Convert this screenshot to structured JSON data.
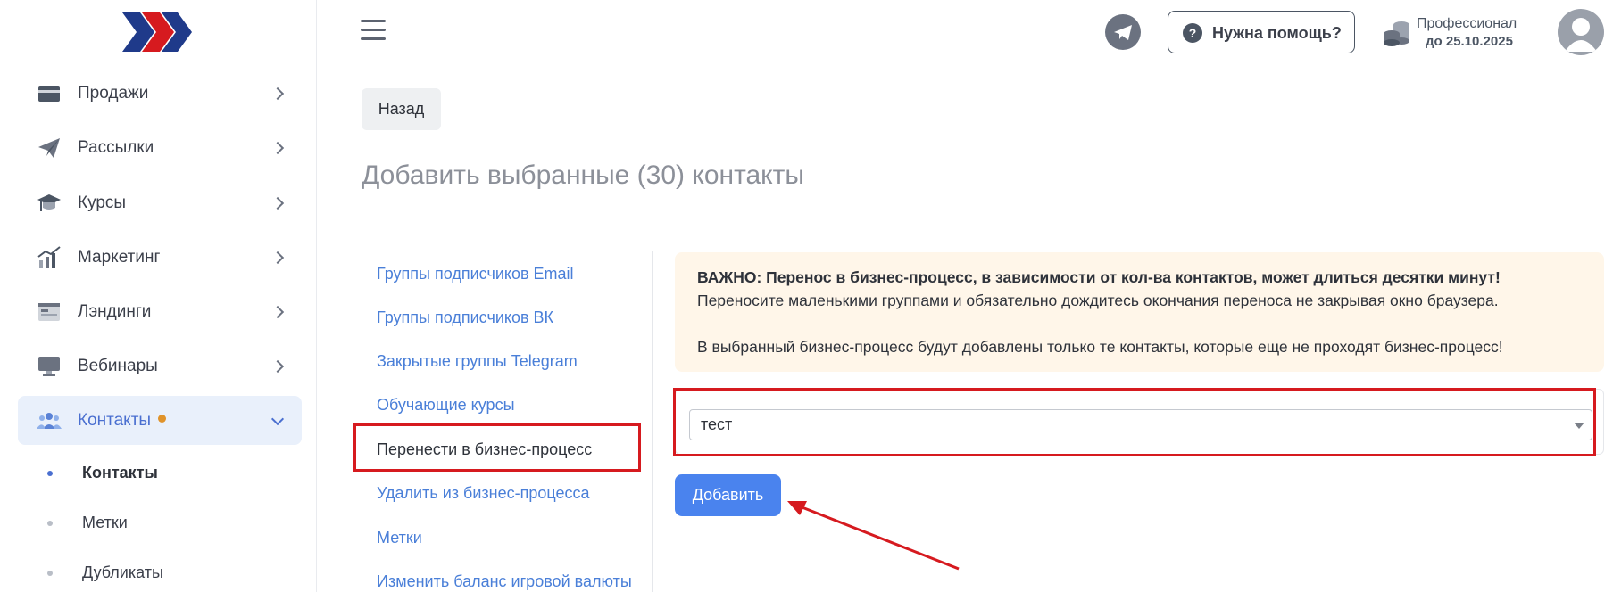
{
  "sidebar": {
    "items": [
      {
        "label": "Продажи",
        "icon": "card-icon"
      },
      {
        "label": "Рассылки",
        "icon": "paper-plane-icon"
      },
      {
        "label": "Курсы",
        "icon": "graduation-cap-icon"
      },
      {
        "label": "Маркетинг",
        "icon": "chart-icon"
      },
      {
        "label": "Лэндинги",
        "icon": "landing-page-icon"
      },
      {
        "label": "Вебинары",
        "icon": "monitor-icon"
      },
      {
        "label": "Контакты",
        "icon": "users-icon"
      }
    ],
    "subitems": [
      {
        "label": "Контакты"
      },
      {
        "label": "Метки"
      },
      {
        "label": "Дубликаты"
      }
    ]
  },
  "header": {
    "help_label": "Нужна помощь?",
    "plan_name": "Профессионал",
    "plan_date": "до 25.10.2025"
  },
  "main": {
    "back_label": "Назад",
    "title": "Добавить выбранные (30) контакты",
    "menu": [
      {
        "label": "Группы подписчиков Email"
      },
      {
        "label": "Группы подписчиков ВК"
      },
      {
        "label": "Закрытые группы Telegram"
      },
      {
        "label": "Обучающие курсы"
      },
      {
        "label": "Перенести в бизнес-процесс"
      },
      {
        "label": "Удалить из бизнес-процесса"
      },
      {
        "label": "Метки"
      },
      {
        "label": "Изменить баланс игровой валюты"
      }
    ],
    "alert": {
      "line1": "ВАЖНО: Перенос в бизнес-процесс, в зависимости от кол-ва контактов, может длиться десятки минут!",
      "line2": "Переносите маленькими группами и обязательно дождитесь окончания переноса не закрывая окно браузера.",
      "line3": "В выбранный бизнес-процесс будут добавлены только те контакты, которые еще не проходят бизнес-процесс!"
    },
    "select_value": "тест",
    "add_label": "Добавить"
  },
  "colors": {
    "accent": "#4a83ee",
    "link": "#4a7fd8",
    "highlight": "#d61a1f",
    "alert_bg": "#fff6e9"
  }
}
